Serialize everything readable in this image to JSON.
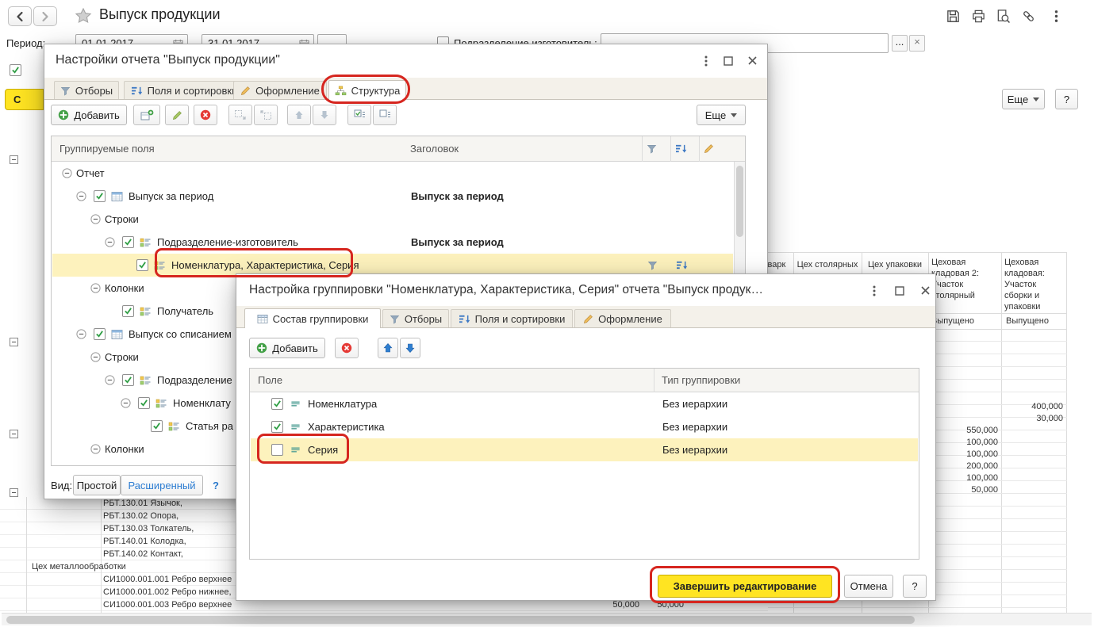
{
  "annotation_color": "#d6261f",
  "app": {
    "title": "Выпуск продукции",
    "period": {
      "label": "Период:",
      "from": "01.01.2017",
      "to": "31.01.2017",
      "separator": "–"
    },
    "producer": {
      "label": "Подразделение изготовитель:",
      "more": "...",
      "clear": "×"
    },
    "generate_fragment": "С",
    "more_button": "Еще",
    "help_button": "?",
    "report": {
      "col1": "сварк",
      "col2": "Цех столярных",
      "col3": "Цех упаковки",
      "col4": "Цеховая кладовая 2: Участок столярный",
      "col5": "Цеховая кладовая: Участок сборки и упаковки",
      "subheader4": "Выпущено",
      "subheader5": "Выпущено",
      "col4_values": [
        "550,000",
        "100,000",
        "100,000",
        "200,000",
        "100,000",
        "50,000"
      ],
      "col5_values": [
        "400,000",
        "30,000"
      ],
      "bottom_values": [
        "50,000",
        "50,000"
      ],
      "left_rows": [
        "РБТ.130.01 Язычок,",
        "РБТ.130.02 Опора,",
        "РБТ.130.03 Толкатель,",
        "РБТ.140.01 Колодка,",
        "РБТ.140.02 Контакт,",
        "Цех металлообработки",
        "СИ1000.001.001 Ребро верхнее",
        "СИ1000.001.002 Ребро нижнее,",
        "СИ1000.001.003 Ребро верхнее"
      ]
    }
  },
  "settings_dialog": {
    "title": "Настройки отчета \"Выпуск продукции\"",
    "tabs": [
      {
        "label": "Отборы"
      },
      {
        "label": "Поля и сортировки"
      },
      {
        "label": "Оформление"
      },
      {
        "label": "Структура"
      }
    ],
    "toolbar": {
      "add": "Добавить",
      "more": "Еще"
    },
    "columns": {
      "fields": "Группируемые поля",
      "header": "Заголовок"
    },
    "rows": [
      {
        "label": "Отчет"
      },
      {
        "label": "Выпуск за период",
        "header": "Выпуск за период",
        "checked": true
      },
      {
        "label": "Строки"
      },
      {
        "label": "Подразделение-изготовитель",
        "header": "Выпуск за период",
        "checked": true
      },
      {
        "label": "Номенклатура, Характеристика, Серия",
        "checked": true,
        "selected": true
      },
      {
        "label": "Колонки"
      },
      {
        "label": "Получатель",
        "checked": true
      },
      {
        "label": "Выпуск со списанием",
        "checked": true
      },
      {
        "label": "Строки"
      },
      {
        "label": "Подразделение",
        "checked": true
      },
      {
        "label": "Номенклату",
        "checked": true
      },
      {
        "label": "Статья ра",
        "checked": true
      },
      {
        "label": "Колонки"
      }
    ],
    "view": {
      "label": "Вид:",
      "simple": "Простой",
      "extended": "Расширенный",
      "help": "?"
    }
  },
  "grouping_dialog": {
    "title": "Настройка группировки \"Номенклатура, Характеристика, Серия\" отчета \"Выпуск продук…",
    "tabs": [
      {
        "label": "Состав группировки"
      },
      {
        "label": "Отборы"
      },
      {
        "label": "Поля и сортировки"
      },
      {
        "label": "Оформление"
      }
    ],
    "toolbar": {
      "add": "Добавить"
    },
    "columns": {
      "field": "Поле",
      "type": "Тип группировки"
    },
    "rows": [
      {
        "field": "Номенклатура",
        "type": "Без иерархии",
        "checked": true
      },
      {
        "field": "Характеристика",
        "type": "Без иерархии",
        "checked": true
      },
      {
        "field": "Серия",
        "type": "Без иерархии",
        "checked": false,
        "selected": true
      }
    ],
    "finish_button": "Завершить редактирование",
    "cancel_button": "Отмена",
    "help_button": "?"
  }
}
